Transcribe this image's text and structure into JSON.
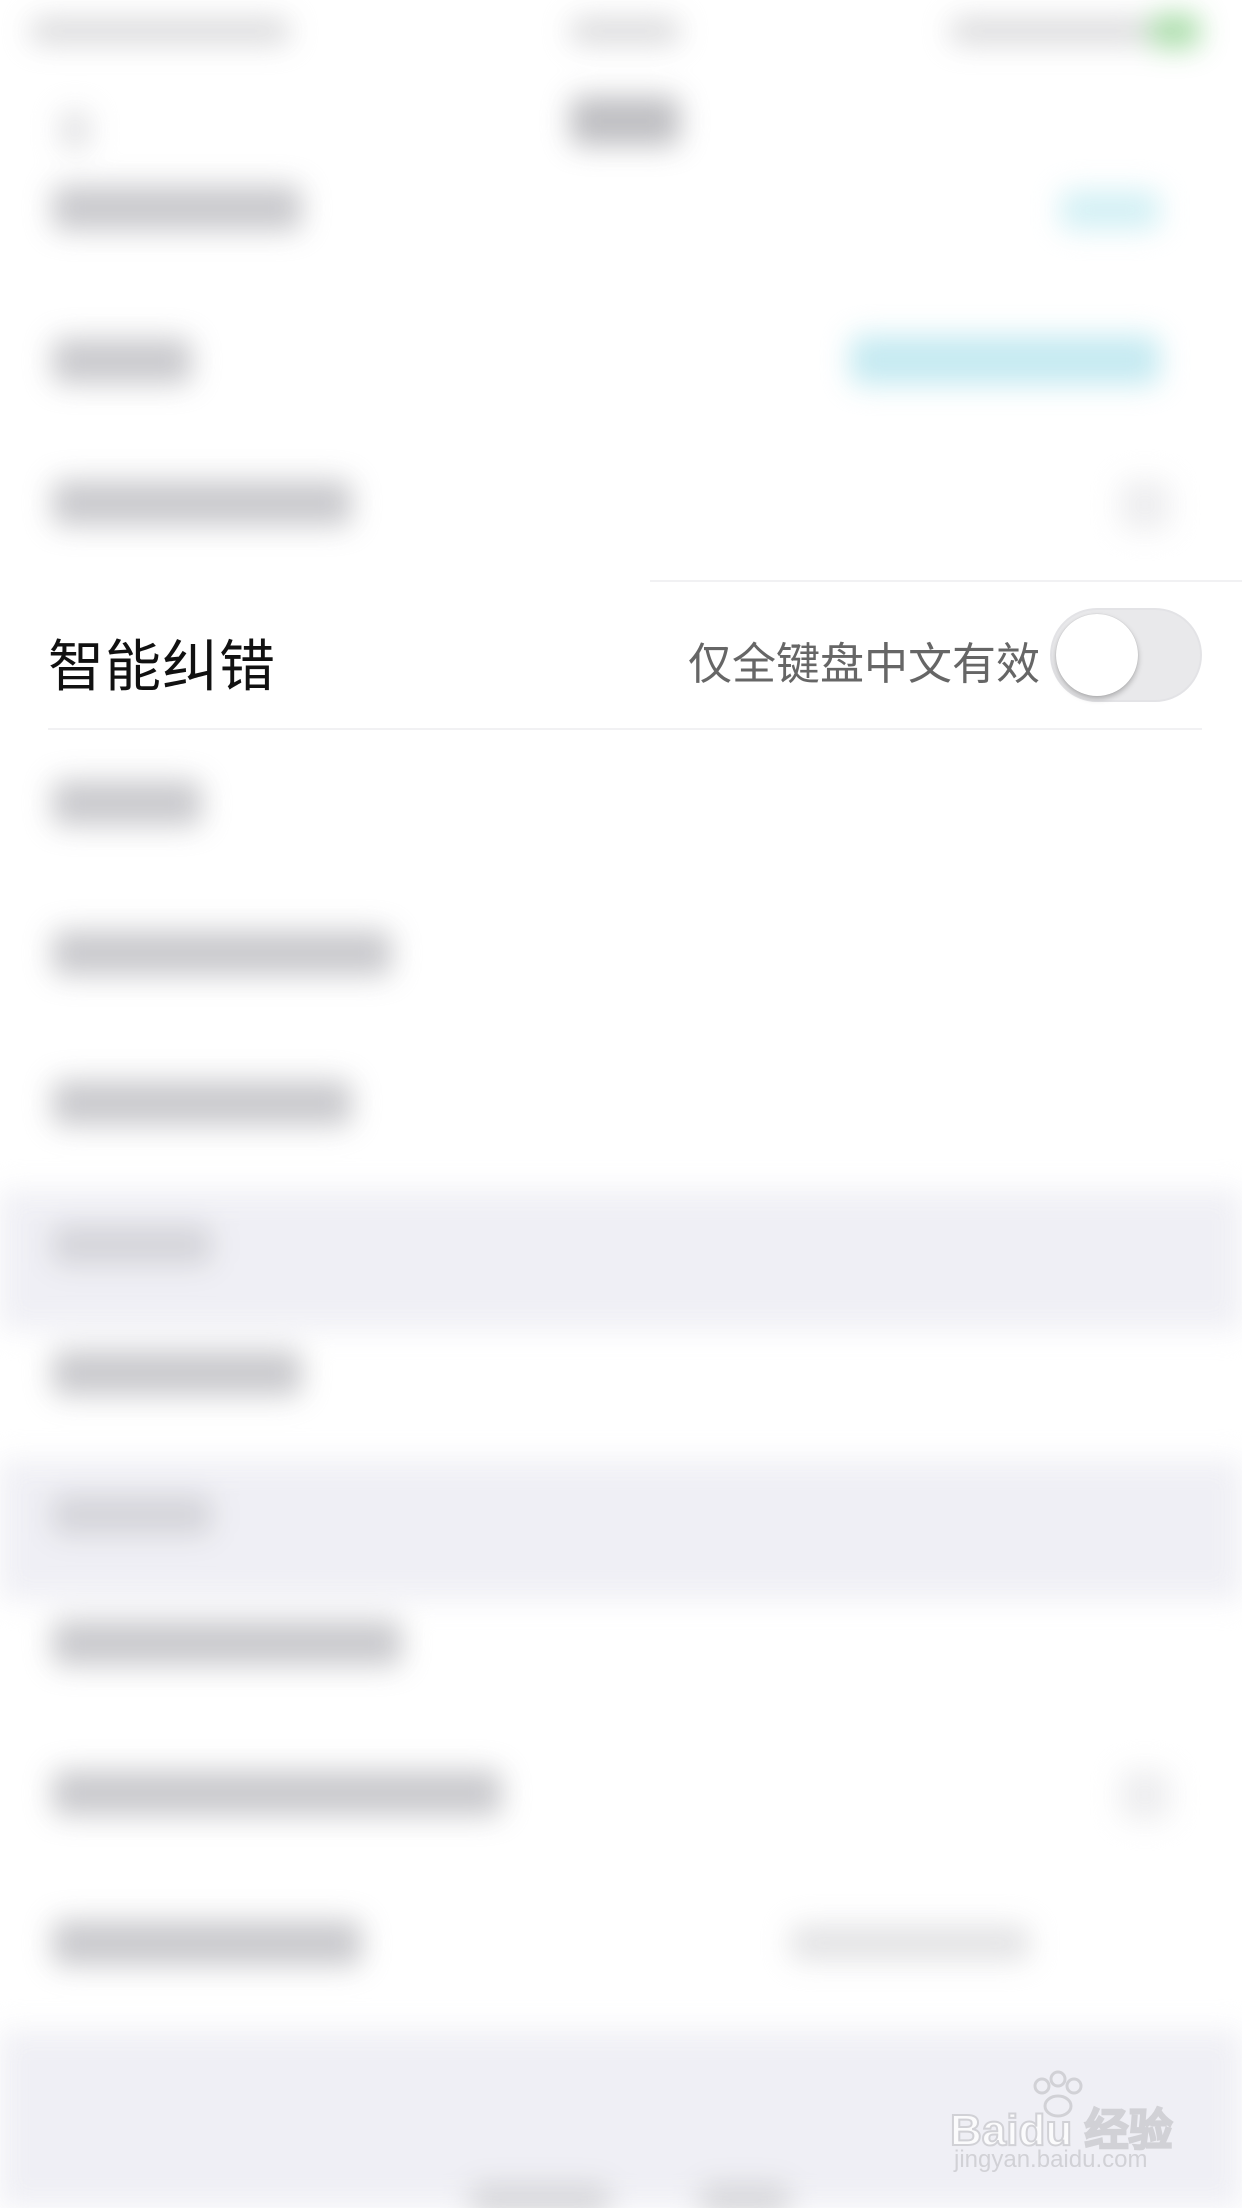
{
  "setting_row": {
    "title": "智能纠错",
    "hint": "仅全键盘中文有效",
    "toggle_on": false
  },
  "watermark": {
    "brand": "Baidu 经验",
    "url": "jingyan.baidu.com"
  },
  "colors": {
    "background": "#ffffff",
    "group_band": "#eeeef4",
    "toggle_off_track": "#e9e9eb",
    "accent_blurred": "#bfe8f0"
  }
}
